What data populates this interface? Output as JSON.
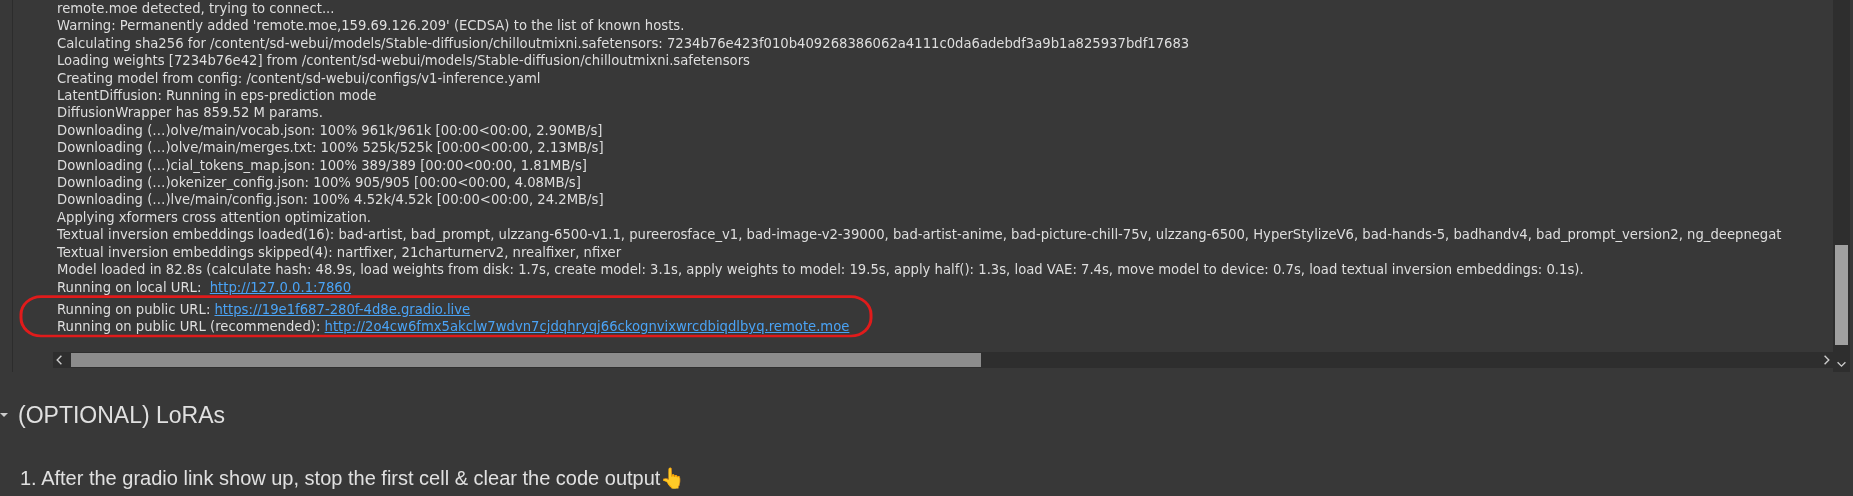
{
  "output": {
    "lines": [
      {
        "text": "remote.moe detected, trying to connect..."
      },
      {
        "text": "Warning: Permanently added 'remote.moe,159.69.126.209' (ECDSA) to the list of known hosts."
      },
      {
        "text": "Calculating sha256 for /content/sd-webui/models/Stable-diffusion/chilloutmixni.safetensors: 7234b76e423f010b409268386062a4111c0da6adebdf3a9b1a825937bdf17683"
      },
      {
        "text": "Loading weights [7234b76e42] from /content/sd-webui/models/Stable-diffusion/chilloutmixni.safetensors"
      },
      {
        "text": "Creating model from config: /content/sd-webui/configs/v1-inference.yaml"
      },
      {
        "text": "LatentDiffusion: Running in eps-prediction mode"
      },
      {
        "text": "DiffusionWrapper has 859.52 M params."
      },
      {
        "text": "Downloading (…)olve/main/vocab.json: 100% 961k/961k [00:00<00:00, 2.90MB/s]"
      },
      {
        "text": "Downloading (…)olve/main/merges.txt: 100% 525k/525k [00:00<00:00, 2.13MB/s]"
      },
      {
        "text": "Downloading (…)cial_tokens_map.json: 100% 389/389 [00:00<00:00, 1.81MB/s]"
      },
      {
        "text": "Downloading (…)okenizer_config.json: 100% 905/905 [00:00<00:00, 4.08MB/s]"
      },
      {
        "text": "Downloading (…)lve/main/config.json: 100% 4.52k/4.52k [00:00<00:00, 24.2MB/s]"
      },
      {
        "text": "Applying xformers cross attention optimization."
      },
      {
        "text": "Textual inversion embeddings loaded(16): bad-artist, bad_prompt, ulzzang-6500-v1.1, pureerosface_v1, bad-image-v2-39000, bad-artist-anime, bad-picture-chill-75v, ulzzang-6500, HyperStylizeV6, bad-hands-5, badhandv4, bad_prompt_version2, ng_deepnegat"
      },
      {
        "text": "Textual inversion embeddings skipped(4): nartfixer, 21charturnerv2, nrealfixer, nfixer"
      },
      {
        "text": "Model loaded in 82.8s (calculate hash: 48.9s, load weights from disk: 1.7s, create model: 3.1s, apply weights to model: 19.5s, apply half(): 1.3s, load VAE: 7.4s, move model to device: 0.7s, load textual inversion embeddings: 0.1s)."
      },
      {
        "text": "Running on local URL:  ",
        "link": "http://127.0.0.1:7860"
      },
      {
        "text": "Running on public URL: ",
        "link": "https://19e1f687-280f-4d8e.gradio.live"
      },
      {
        "text": "Running on public URL (recommended): ",
        "link": "http://2o4cw6fmx5akclw7wdvn7cjdqhryqj66ckognvixwrcdbiqdlbyq.remote.moe"
      }
    ]
  },
  "section": {
    "title": "(OPTIONAL) LoRAs",
    "expanded": true
  },
  "steps": [
    "1. After the gradio link show up, stop the first cell & clear the code output👆"
  ]
}
